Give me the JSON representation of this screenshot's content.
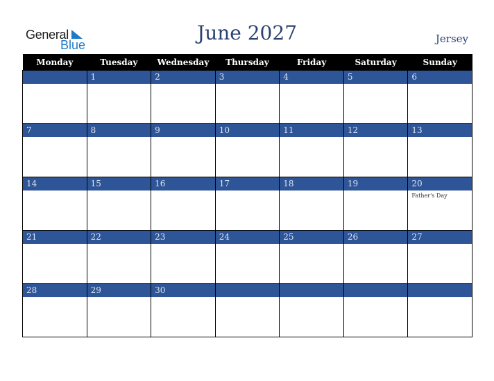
{
  "logo": {
    "line1": "General",
    "line2": "Blue"
  },
  "header": {
    "title": "June 2027",
    "region": "Jersey"
  },
  "weekdays": [
    "Monday",
    "Tuesday",
    "Wednesday",
    "Thursday",
    "Friday",
    "Saturday",
    "Sunday"
  ],
  "weeks": [
    [
      "",
      "1",
      "2",
      "3",
      "4",
      "5",
      "6"
    ],
    [
      "7",
      "8",
      "9",
      "10",
      "11",
      "12",
      "13"
    ],
    [
      "14",
      "15",
      "16",
      "17",
      "18",
      "19",
      "20"
    ],
    [
      "21",
      "22",
      "23",
      "24",
      "25",
      "26",
      "27"
    ],
    [
      "28",
      "29",
      "30",
      "",
      "",
      "",
      ""
    ]
  ],
  "events": {
    "20": "Father's Day"
  },
  "colors": {
    "band": "#2e5597",
    "title": "#2b4170",
    "header_bg": "#000000",
    "logo_blue": "#1f7bc8"
  }
}
